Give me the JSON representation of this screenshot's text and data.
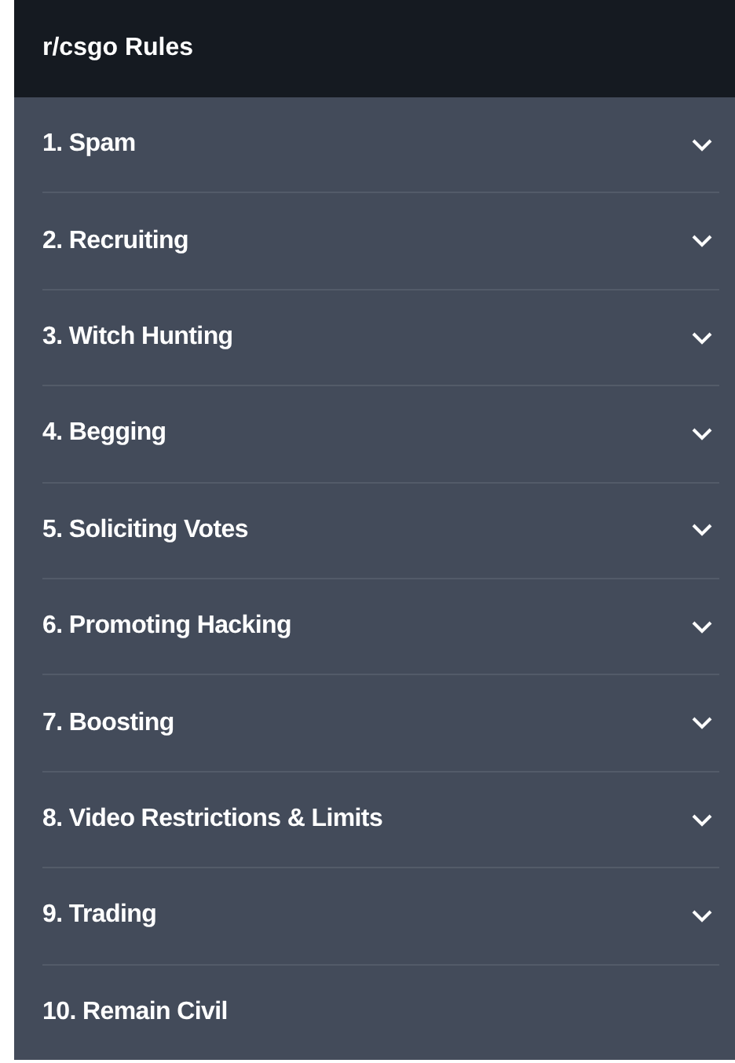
{
  "header": {
    "title": "r/csgo Rules"
  },
  "rules": [
    {
      "label": "1. Spam",
      "expandable": true
    },
    {
      "label": "2. Recruiting",
      "expandable": true
    },
    {
      "label": "3. Witch Hunting",
      "expandable": true
    },
    {
      "label": "4. Begging",
      "expandable": true
    },
    {
      "label": "5. Soliciting Votes",
      "expandable": true
    },
    {
      "label": "6. Promoting Hacking",
      "expandable": true
    },
    {
      "label": "7. Boosting",
      "expandable": true
    },
    {
      "label": "8. Video Restrictions & Limits",
      "expandable": true
    },
    {
      "label": "9. Trading",
      "expandable": true
    },
    {
      "label": "10. Remain Civil",
      "expandable": false
    }
  ]
}
